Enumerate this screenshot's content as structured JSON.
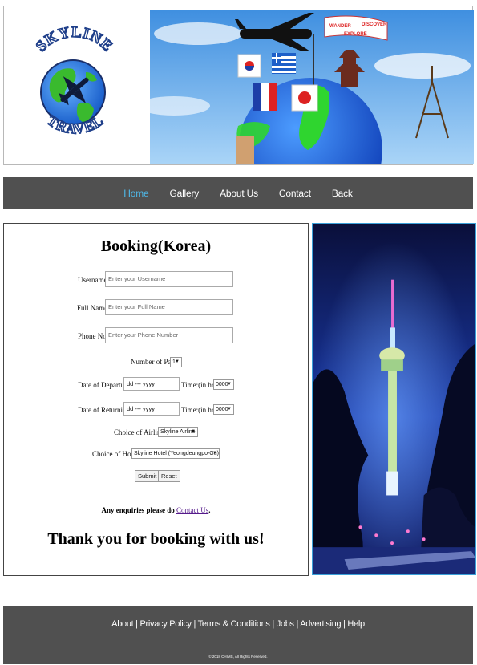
{
  "header": {
    "logo_top_text": "SKYLINE",
    "logo_bottom_text": "TRAVEL",
    "banner_flag_text1": "WANDER",
    "banner_flag_text2": "DISCOVER",
    "banner_flag_text3": "EXPLORE"
  },
  "nav": {
    "items": [
      {
        "label": "Home"
      },
      {
        "label": "Gallery"
      },
      {
        "label": "About Us"
      },
      {
        "label": "Contact"
      },
      {
        "label": "Back"
      }
    ]
  },
  "form": {
    "title": "Booking(Korea)",
    "username_label": "Username:",
    "username_placeholder": "Enter your Username",
    "fullname_label": "Full Name:",
    "fullname_placeholder": "Enter your Full Name",
    "phone_label": "Phone No:",
    "phone_placeholder": "Enter your Phone Number",
    "pax_label": "Number of Pax:",
    "pax_value": "1",
    "departure_label": "Date of Departure:",
    "departure_value": "dd --- yyyy",
    "departure_time_label": "Time:(in hrs)",
    "departure_time_value": "0000",
    "return_label": "Date of Returning:",
    "return_value": "dd --- yyyy",
    "return_time_label": "Time:(in hrs)",
    "return_time_value": "0000",
    "airline_label": "Choice of Airline:",
    "airline_value": "Skyline Airline",
    "hotel_label": "Choice of Hotel:",
    "hotel_value": "Skyline Hotel (Yeongdeungpo-Gu)",
    "submit_label": "Submit",
    "reset_label": "Reset",
    "enquiry_text": "Any enquiries please do",
    "enquiry_link": "Contact Us",
    "enquiry_end": ".",
    "thanks": "Thank you for booking with us!"
  },
  "footer": {
    "links": [
      "About",
      "Privacy Policy",
      "Terms & Conditions",
      "Jobs",
      "Advertising",
      "Help"
    ],
    "copyright": "© 2018 CHIMS, All Rights Reserved."
  },
  "colors": {
    "nav_bg": "#505050",
    "nav_active": "#4fb8e8",
    "link_visited": "#551a8b"
  }
}
